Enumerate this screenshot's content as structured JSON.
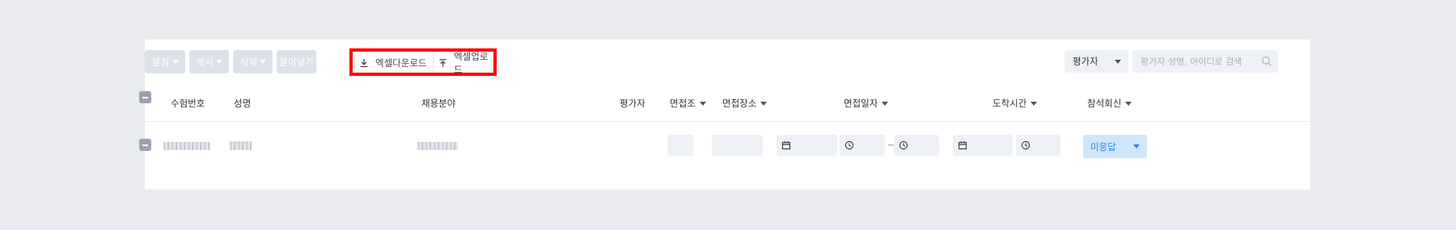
{
  "toolbar": {
    "paste_label": "붙침",
    "copy_label": "복사",
    "delete_label": "삭제",
    "insert_label": "붙여넣기",
    "excel_download_label": "엑셀다운로드",
    "excel_upload_label": "엑셀업로드"
  },
  "filter": {
    "selected": "평가자",
    "search_placeholder": "평가자 성명, 아이디로 검색"
  },
  "columns": {
    "exam_no": "수험번호",
    "name": "성명",
    "field": "채용분야",
    "evaluator": "평가자",
    "group": "면접조",
    "place": "면접장소",
    "date": "면접일자",
    "arrival": "도착시간",
    "attend": "참석회신"
  },
  "row": {
    "date_range_separator": "~",
    "attendance_value": "미응답"
  },
  "colors": {
    "highlight_border": "#ff0000",
    "response_bg": "#cfe7fb",
    "response_text": "#1e88e5"
  }
}
